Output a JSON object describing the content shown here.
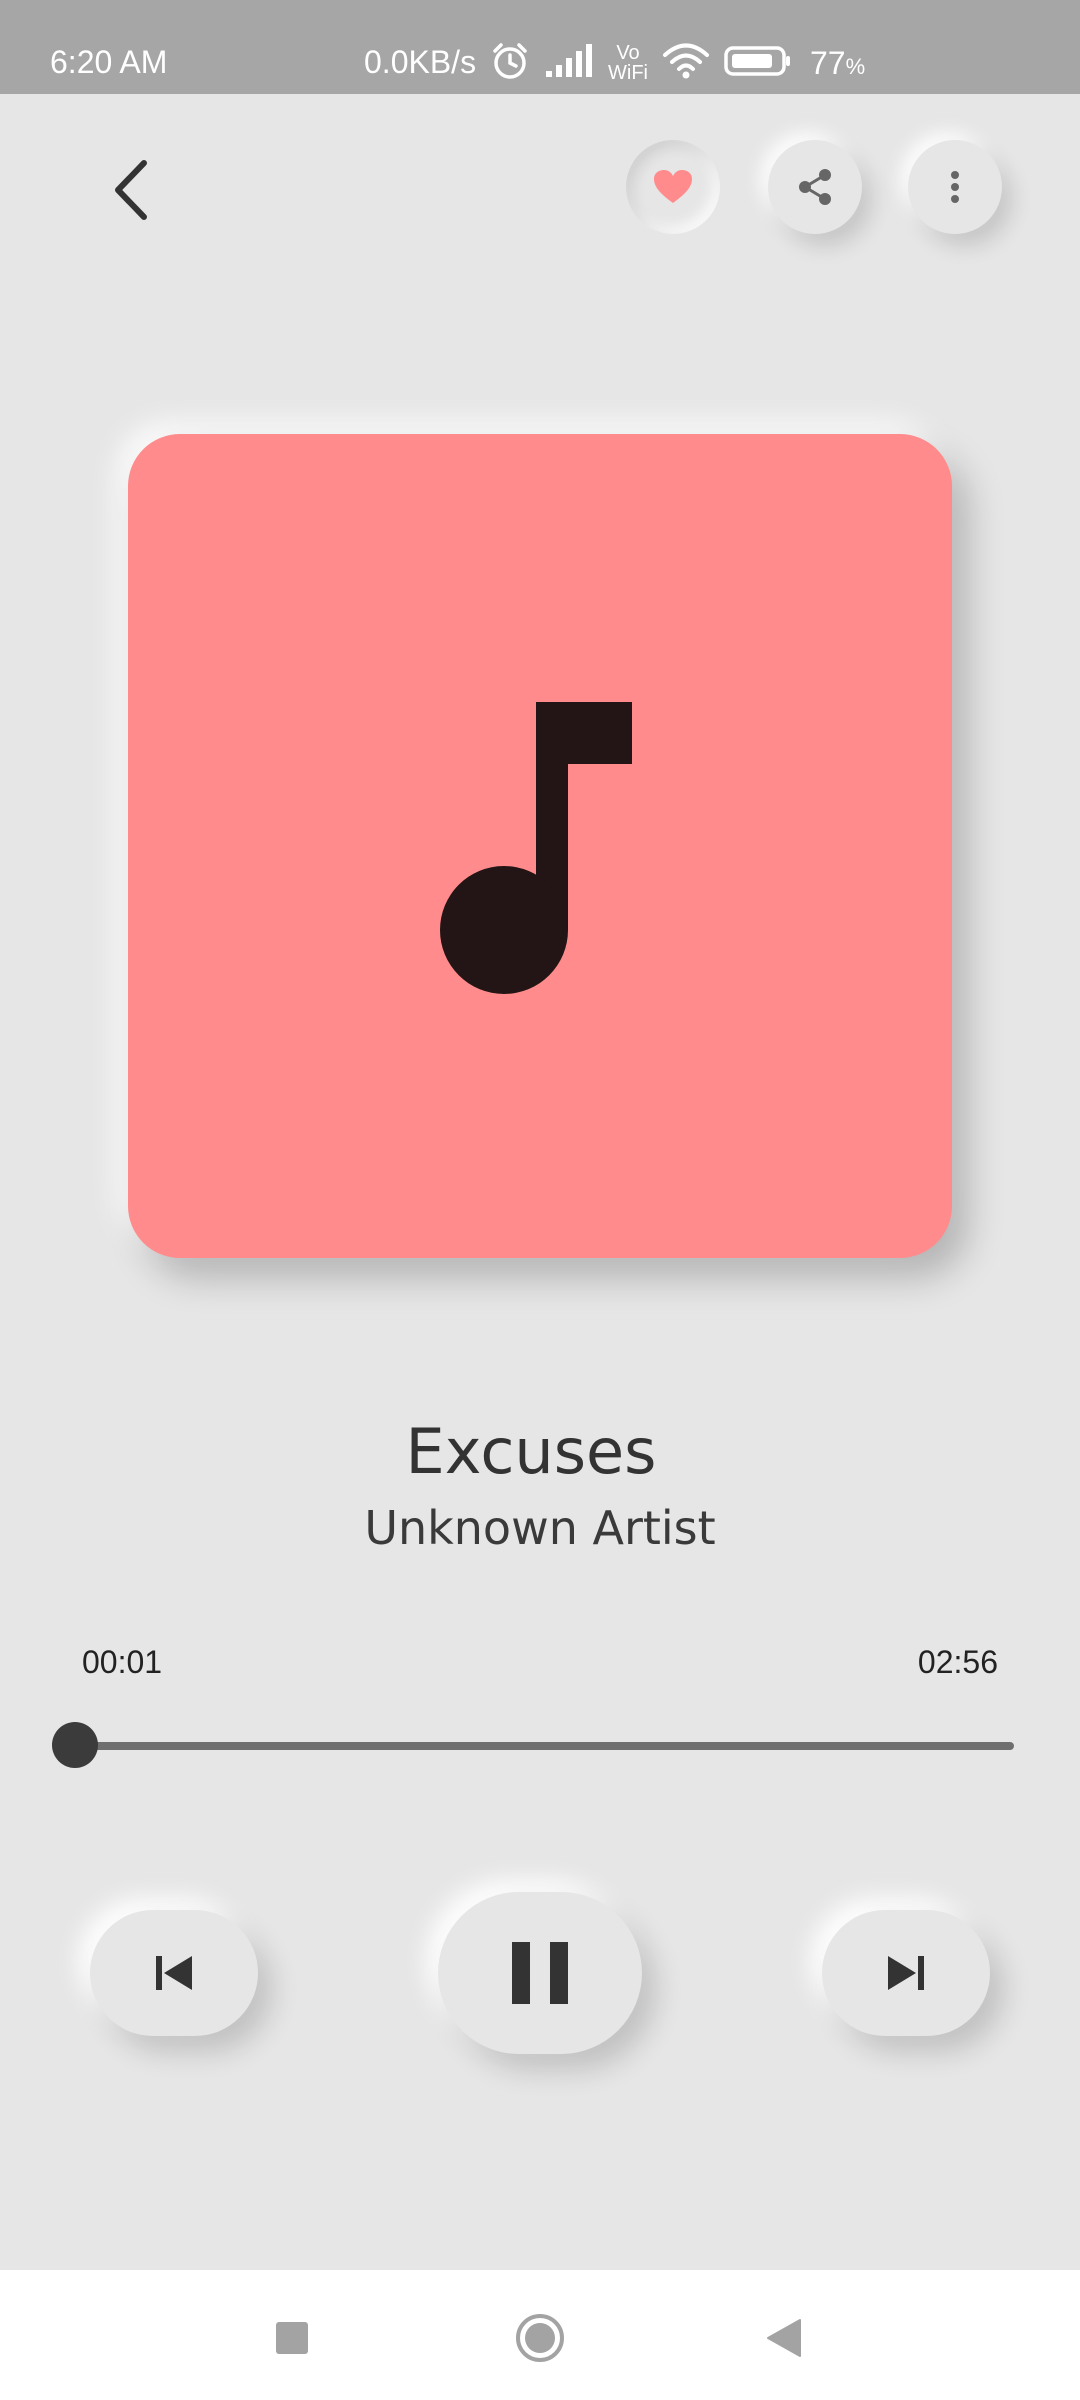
{
  "status_bar": {
    "time": "6:20 AM",
    "net_speed": "0.0KB/s",
    "vowifi_top": "Vo",
    "vowifi_bottom": "WiFi",
    "battery_level": "77",
    "battery_unit": "%",
    "icons": [
      "alarm-icon",
      "signal-icon",
      "vowifi-icon",
      "wifi-icon",
      "battery-icon"
    ]
  },
  "top_bar": {
    "icons": [
      "chevron-left-icon",
      "heart-icon",
      "share-icon",
      "more-vert-icon"
    ],
    "favorite_active": true
  },
  "album_art": {
    "icon": "music-note-icon"
  },
  "track": {
    "title": "Excuses",
    "artist": "Unknown Artist"
  },
  "progress": {
    "elapsed": "00:01",
    "duration": "02:56",
    "fraction": 0.0057
  },
  "controls": {
    "icons": [
      "skip-previous-icon",
      "pause-icon",
      "skip-next-icon"
    ]
  },
  "nav_bar": {
    "icons": [
      "recents-square-icon",
      "home-circle-icon",
      "back-triangle-icon"
    ]
  },
  "colors": {
    "background": "#e6e6e6",
    "status_bar": "#a6a6a6",
    "album_art": "#ff8b8c",
    "accent_heart": "#ff8b8c",
    "note": "#231515",
    "text_primary": "#333333",
    "track_line": "#6f6f6f",
    "thumb": "#3b3b3b"
  }
}
